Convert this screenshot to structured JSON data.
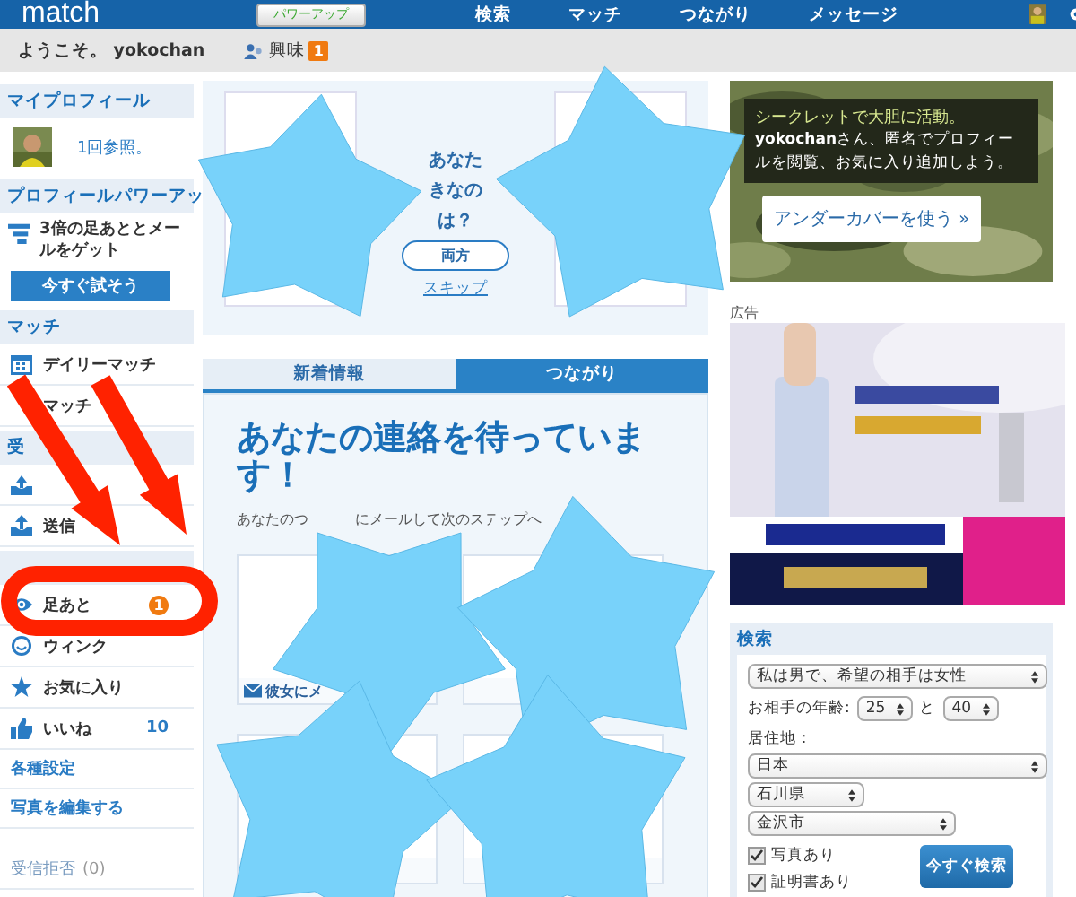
{
  "top_bar": {
    "logo": "match",
    "powerup_button": "パワーアップ",
    "nav": [
      "検索",
      "マッチ",
      "つながり",
      "メッセージ"
    ]
  },
  "sub_bar": {
    "welcome": "ようこそ。 yokochan",
    "interest_label": "興味",
    "interest_badge": "1"
  },
  "sidebar": [
    {
      "kind": "header",
      "label": "マイプロフィール"
    },
    {
      "kind": "profile",
      "label": "1回参照。"
    },
    {
      "kind": "header",
      "label": "プロフィールパワーアッ"
    },
    {
      "kind": "promo",
      "label": "3倍の足あととメールをゲット"
    },
    {
      "kind": "button",
      "label": "今すぐ試そう"
    },
    {
      "kind": "header",
      "label": "マッチ"
    },
    {
      "kind": "item",
      "label": "デイリーマッチ"
    },
    {
      "kind": "item",
      "label": "マッチ"
    },
    {
      "kind": "header",
      "label": "受"
    },
    {
      "kind": "item"
    },
    {
      "kind": "item",
      "label": "送信"
    },
    {
      "kind": "header"
    },
    {
      "kind": "item",
      "label": "足あと",
      "badge": "1"
    },
    {
      "kind": "item",
      "label": "ウィンク"
    },
    {
      "kind": "item",
      "label": "お気に入り"
    },
    {
      "kind": "item",
      "label": "いいね",
      "count": "10"
    },
    {
      "kind": "link",
      "label": "各種設定",
      "disabled": false
    },
    {
      "kind": "link",
      "label": "写真を編集する",
      "disabled": false
    },
    {
      "kind": "link",
      "label": "受信拒否",
      "count": "(0)",
      "disabled": true
    }
  ],
  "question": {
    "lines": [
      "あなた",
      "きなの",
      "は？"
    ],
    "button": "両方",
    "skip": "スキップ"
  },
  "tabs": [
    {
      "label": "新着情報",
      "selected": false
    },
    {
      "label": "つながり",
      "selected": true
    }
  ],
  "connections": {
    "heading": "あなたの連絡を待っています！",
    "subtitle_parts": [
      "あなたのつ",
      "にメールして次のステップへ"
    ],
    "cards": [
      {
        "kind": "card",
        "action": "彼女にメ"
      },
      {
        "kind": "card"
      },
      {
        "kind": "card"
      },
      {
        "kind": "card"
      }
    ]
  },
  "undercover": {
    "text": "**yokochan**さん、匿名でプロフィールを閲覧、お気に入り追加しよう。",
    "title": "シークレットで大胆に活動。",
    "button": "アンダーカバーを使う »"
  },
  "ad": {
    "label": "広告",
    "kind": "picture"
  },
  "search": {
    "title": "検索",
    "gender": "私は男で、希望の相手は女性",
    "age_label": "お相手の年齢:",
    "age_min": "25",
    "age_sep": "と",
    "age_max": "40",
    "location_label": "居住地：",
    "country": "日本",
    "prefecture": "石川県",
    "city": "金沢市",
    "checkboxes": [
      {
        "label": "写真あり",
        "checked": true
      },
      {
        "label": "証明書あり",
        "checked": true
      }
    ],
    "button": "今すぐ検索"
  },
  "overlays": [
    {
      "kind": "star"
    },
    {
      "kind": "star"
    },
    {
      "kind": "star"
    },
    {
      "kind": "star"
    },
    {
      "kind": "star"
    },
    {
      "kind": "star"
    },
    {
      "kind": "arrow"
    },
    {
      "kind": "arrow"
    },
    {
      "kind": "ring"
    }
  ]
}
